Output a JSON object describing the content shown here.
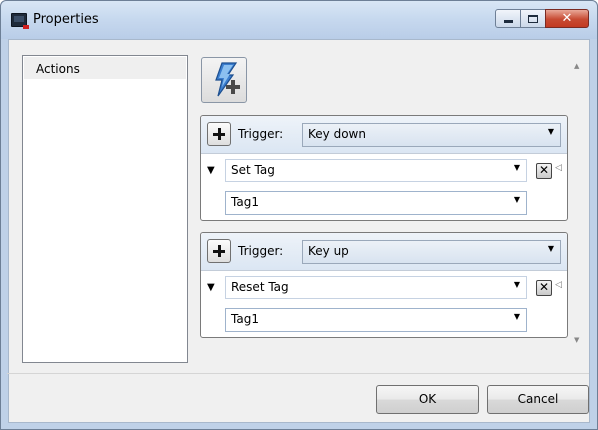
{
  "window": {
    "title": "Properties",
    "icon": "application-icon",
    "caption_buttons": {
      "minimize": "minimize-icon",
      "maximize": "maximize-icon",
      "close": "✕"
    }
  },
  "sidebar": {
    "items": [
      {
        "label": "Actions",
        "selected": true
      }
    ]
  },
  "toolbar": {
    "add_action_icon": "lightning-add-icon"
  },
  "triggers": [
    {
      "label": "Trigger:",
      "value": "Key down",
      "action": "Set Tag",
      "tag": "Tag1"
    },
    {
      "label": "Trigger:",
      "value": "Key up",
      "action": "Reset Tag",
      "tag": "Tag1"
    }
  ],
  "footer": {
    "ok_label": "OK",
    "cancel_label": "Cancel"
  },
  "colors": {
    "title_bar": "#c6d8ee",
    "close_button": "#c74a32",
    "client": "#f0f0f0"
  }
}
